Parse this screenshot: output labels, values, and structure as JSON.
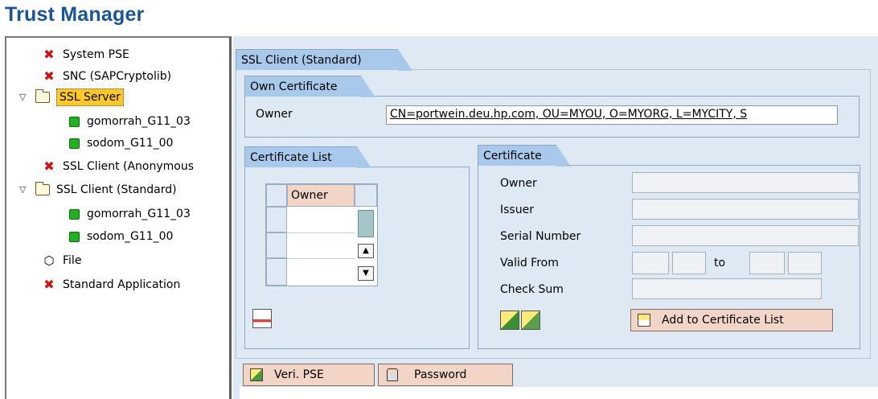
{
  "app": {
    "title": "Trust Manager"
  },
  "tree": {
    "items": [
      {
        "label": "System PSE",
        "icon": "red-x-icon"
      },
      {
        "label": "SNC (SAPCryptolib)",
        "icon": "red-x-icon"
      },
      {
        "label": "SSL Server",
        "icon": "folder-icon",
        "expanded": true,
        "selected": true
      },
      {
        "label": "gomorrah_G11_03",
        "icon": "green-square-icon"
      },
      {
        "label": "sodom_G11_00",
        "icon": "green-square-icon"
      },
      {
        "label": "SSL Client (Anonymous",
        "icon": "red-x-icon"
      },
      {
        "label": "SSL Client (Standard)",
        "icon": "folder-icon",
        "expanded": true
      },
      {
        "label": "gomorrah_G11_03",
        "icon": "green-square-icon"
      },
      {
        "label": "sodom_G11_00",
        "icon": "green-square-icon"
      },
      {
        "label": "File",
        "icon": "cube-icon"
      },
      {
        "label": "Standard Application",
        "icon": "red-x-icon"
      }
    ]
  },
  "main": {
    "section_title": "SSL Client (Standard)",
    "own_certificate": {
      "title": "Own Certificate",
      "owner_label": "Owner",
      "owner_value": "CN=portwein.deu.hp.com, OU=MYOU, O=MYORG, L=MYCITY, S"
    },
    "certificate_list": {
      "title": "Certificate List",
      "column_header": "Owner"
    },
    "certificate": {
      "title": "Certificate",
      "owner_label": "Owner",
      "issuer_label": "Issuer",
      "serial_label": "Serial Number",
      "valid_from_label": "Valid From",
      "to_label": "to",
      "checksum_label": "Check Sum",
      "add_button": "Add to Certificate List"
    },
    "footer_buttons": {
      "veri_pse": "Veri. PSE",
      "password": "Password"
    }
  },
  "colors": {
    "title": "#1a5597",
    "panel_bg": "#dfe9f4",
    "tab_bg": "#a8c8ec",
    "button_bg": "#f3d5c7",
    "selection": "#ffc829"
  }
}
